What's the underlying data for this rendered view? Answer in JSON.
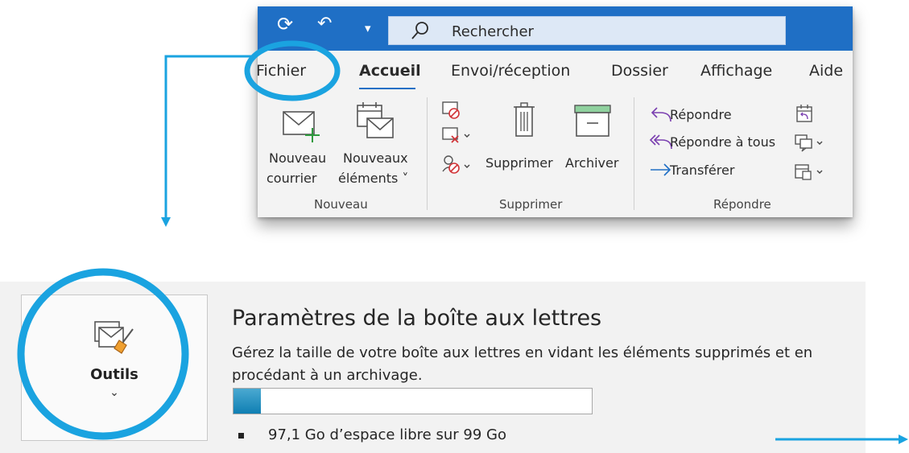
{
  "ribbon": {
    "search": {
      "label": "Rechercher"
    },
    "tabs": [
      "Fichier",
      "Accueil",
      "Envoi/réception",
      "Dossier",
      "Affichage",
      "Aide"
    ],
    "active_tab": "Accueil",
    "groups": {
      "nouveau": {
        "label": "Nouveau",
        "new_mail_line1": "Nouveau",
        "new_mail_line2": "courrier",
        "new_items_line1": "Nouveaux",
        "new_items_line2": "éléments ˅"
      },
      "supprimer": {
        "label": "Supprimer",
        "delete": "Supprimer",
        "archive": "Archiver"
      },
      "repondre": {
        "label": "Répondre",
        "reply": "Répondre",
        "reply_all": "Répondre à tous",
        "forward": "Transférer"
      }
    }
  },
  "backstage": {
    "tools_label": "Outils",
    "tools_chevron": "⌄",
    "title": "Paramètres de la boîte aux lettres",
    "description": "Gérez la taille de votre boîte aux lettres en vidant les éléments supprimés et en procédant à un archivage.",
    "space_text": "97,1 Go d’espace libre sur 99 Go",
    "storage_used_fraction": 0.0192
  },
  "colors": {
    "titlebar": "#1f6fc5",
    "annotation": "#1aa3e0",
    "reply_purple": "#7a3fb0",
    "forward_blue": "#1f6fc5"
  }
}
